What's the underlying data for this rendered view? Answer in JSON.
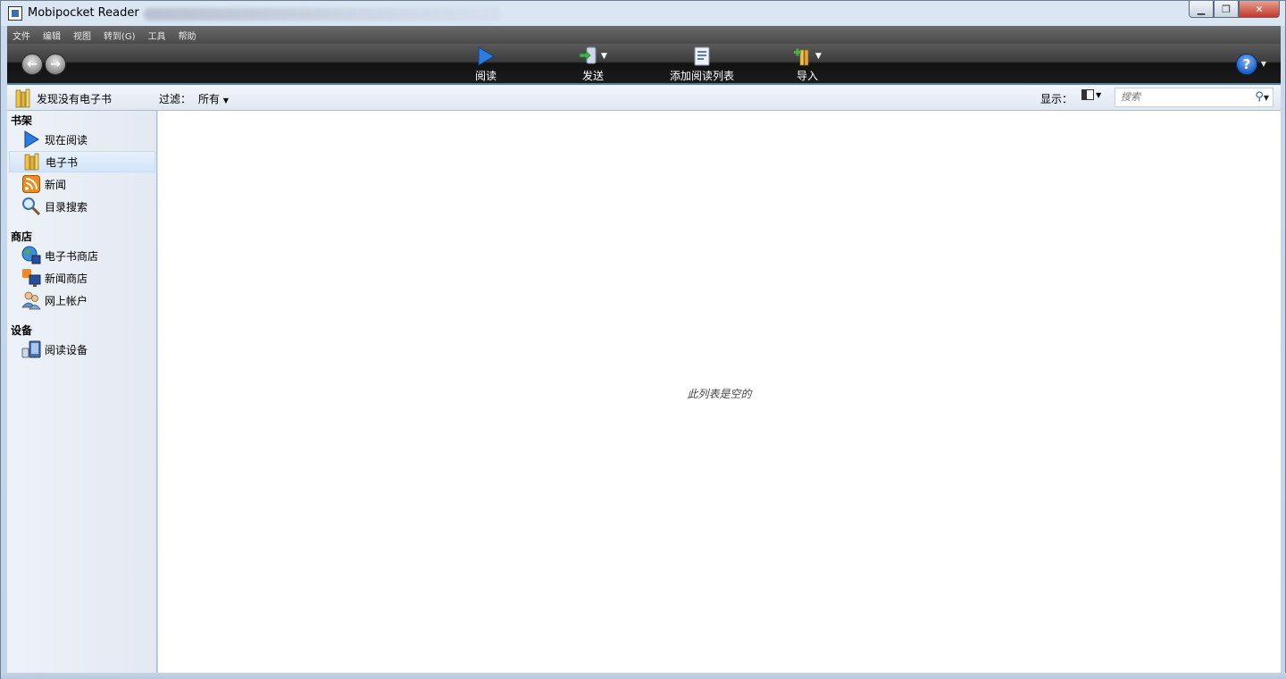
{
  "window": {
    "title": "Mobipocket Reader"
  },
  "menu": [
    "文件",
    "编辑",
    "视图",
    "转到(G)",
    "工具",
    "帮助"
  ],
  "toolbar": {
    "read": "阅读",
    "send": "发送",
    "add_to_reading_list": "添加阅读列表",
    "import": "导入"
  },
  "subheader": {
    "title": "发现没有电子书",
    "filter_label": "过滤：",
    "filter_value": "所有",
    "display_label": "显示：",
    "search_placeholder": "搜索"
  },
  "sidebar": {
    "sections": [
      {
        "title": "书架",
        "items": [
          {
            "label": "现在阅读",
            "icon": "play-icon"
          },
          {
            "label": "电子书",
            "icon": "books-icon",
            "selected": true
          },
          {
            "label": "新闻",
            "icon": "rss-icon"
          },
          {
            "label": "目录搜索",
            "icon": "magnifier-icon"
          }
        ]
      },
      {
        "title": "商店",
        "items": [
          {
            "label": "电子书商店",
            "icon": "globe-icon"
          },
          {
            "label": "新闻商店",
            "icon": "rss-monitor-icon"
          },
          {
            "label": "网上帐户",
            "icon": "users-icon"
          }
        ]
      },
      {
        "title": "设备",
        "items": [
          {
            "label": "阅读设备",
            "icon": "device-icon"
          }
        ]
      }
    ]
  },
  "main": {
    "empty_message": "此列表是空的"
  },
  "colors": {
    "toolbar_accent": "#4f7fbf",
    "selected_bg": "#d2e4f8",
    "close_button": "#c0392b"
  }
}
